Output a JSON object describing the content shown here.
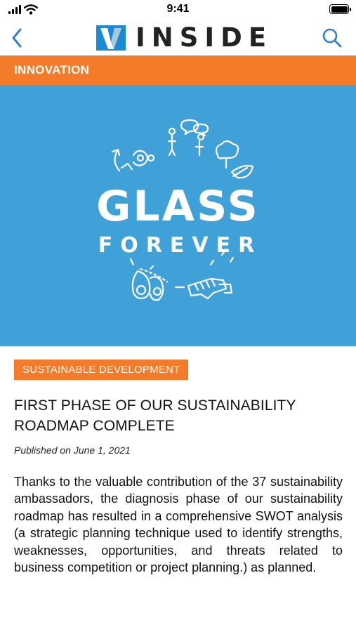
{
  "status_bar": {
    "time": "9:41"
  },
  "nav": {
    "logo_text": "INSIDE",
    "logo_mark_letter": "V",
    "back_icon": "chevron-left-icon",
    "search_icon": "search-icon"
  },
  "colors": {
    "accent_orange": "#f47b2a",
    "hero_blue": "#40a0d8",
    "nav_blue": "#2f80d0",
    "logo_blue": "#1a8ad4"
  },
  "category": {
    "label": "INNOVATION"
  },
  "hero": {
    "title": "GLASS",
    "subtitle": "FOREVER"
  },
  "article": {
    "tag": "SUSTAINABLE DEVELOPMENT",
    "headline": "FIRST PHASE OF OUR SUSTAINABILITY ROADMAP COMPLETE",
    "published": "Published on June 1, 2021",
    "body": "Thanks to the valuable contribution of the 37 sustainability ambassadors, the diagnosis phase of our sustainability roadmap has resulted in a comprehensive SWOT analysis (a strategic planning technique used to identify strengths, weaknesses, opportunities, and threats related to business competition or project planning.) as planned."
  }
}
